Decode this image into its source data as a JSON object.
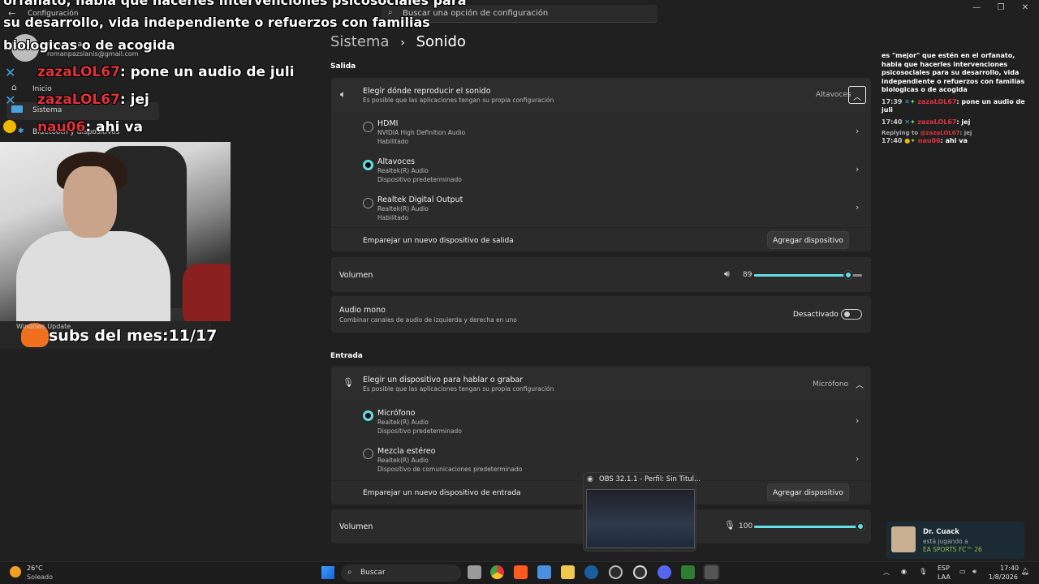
{
  "window": {
    "title": "Configuración",
    "search_placeholder": "Buscar una opción de configuración"
  },
  "user": {
    "name": "roman pa",
    "email": "romanpazslanis@gmail.com"
  },
  "sidebar": {
    "items": [
      {
        "label": "Inicio"
      },
      {
        "label": "Sistema"
      },
      {
        "label": "Bluetooth y dispositivos"
      }
    ],
    "windows_update": "Windows Update"
  },
  "chat_overlay": {
    "top_lines": [
      "orfanato, habia que hacerles intervenciones psicosociales para",
      "su desarrollo, vida independiente o refuerzos con familias",
      "biologicas o de acogida"
    ],
    "messages": [
      {
        "user": "zazaLOL67",
        "text": ": pone un audio de juli"
      },
      {
        "user": "zazaLOL67",
        "text": ": jej"
      },
      {
        "user": "nau06",
        "text": ": ahi va"
      }
    ]
  },
  "subs": {
    "text": "subs del mes:11/17"
  },
  "breadcrumb": {
    "parent": "Sistema",
    "separator": "›",
    "current": "Sonido"
  },
  "output": {
    "section": "Salida",
    "header_title": "Elegir dónde reproducir el sonido",
    "header_sub": "Es posible que las aplicaciones tengan su propia configuración",
    "selected": "Altavoces",
    "devices": [
      {
        "name": "HDMI",
        "driver": "NVIDIA High Definition Audio",
        "status": "Habilitado",
        "selected": false
      },
      {
        "name": "Altavoces",
        "driver": "Realtek(R) Audio",
        "status": "Dispositivo predeterminado",
        "selected": true
      },
      {
        "name": "Realtek Digital Output",
        "driver": "Realtek(R) Audio",
        "status": "Habilitado",
        "selected": false
      }
    ],
    "pair_label": "Emparejar un nuevo dispositivo de salida",
    "pair_button": "Agregar dispositivo",
    "volume_label": "Volumen",
    "volume_value": "89",
    "volume_fraction": 0.89,
    "mono_title": "Audio mono",
    "mono_sub": "Combinar canales de audio de izquierda y derecha en uno",
    "mono_state": "Desactivado"
  },
  "input": {
    "section": "Entrada",
    "header_title": "Elegir un dispositivo para hablar o grabar",
    "header_sub": "Es posible que las aplicaciones tengan su propia configuración",
    "selected": "Micrófono",
    "devices": [
      {
        "name": "Micrófono",
        "driver": "Realtek(R) Audio",
        "status": "Dispositivo predeterminado",
        "selected": true
      },
      {
        "name": "Mezcla estéreo",
        "driver": "Realtek(R) Audio",
        "status": "Dispositivo de comunicaciones predeterminado",
        "selected": false
      }
    ],
    "pair_label": "Emparejar un nuevo dispositivo de entrada",
    "pair_button": "Agregar dispositivo",
    "volume_label": "Volumen",
    "volume_value": "100",
    "volume_fraction": 1.0
  },
  "right_chat": {
    "intro": "es \"mejor\" que estén en el orfanato, habia que hacerles intervenciones psicosociales para su desarrollo, vida independiente o refuerzos con familias biologicas o de acogida",
    "lines": [
      {
        "time": "17:39",
        "user": "zazaLOL67",
        "text": ": pone un audio de juli"
      },
      {
        "time": "17:40",
        "user": "zazaLOL67",
        "text": ": jej"
      },
      {
        "reply": "Replying to",
        "reply_user": "@zazaLOL67",
        "reply_text": ": jej"
      },
      {
        "time": "17:40",
        "user": "nau06",
        "text": ": ahi va"
      }
    ]
  },
  "game_notification": {
    "name": "Dr. Cuack",
    "status": "está jugando a",
    "game": "EA SPORTS FC™ 26"
  },
  "obs_preview": {
    "title": "OBS 32.1.1 - Perfil: Sin Titul..."
  },
  "taskbar": {
    "weather_temp": "26°C",
    "weather_text": "Soleado",
    "search": "Buscar",
    "lang": "ESP",
    "lang2": "LAA",
    "time": "17:40",
    "date": "1/8/2026"
  },
  "colors": {
    "accent": "#62e0e6",
    "chat_user": "#e0323c"
  }
}
